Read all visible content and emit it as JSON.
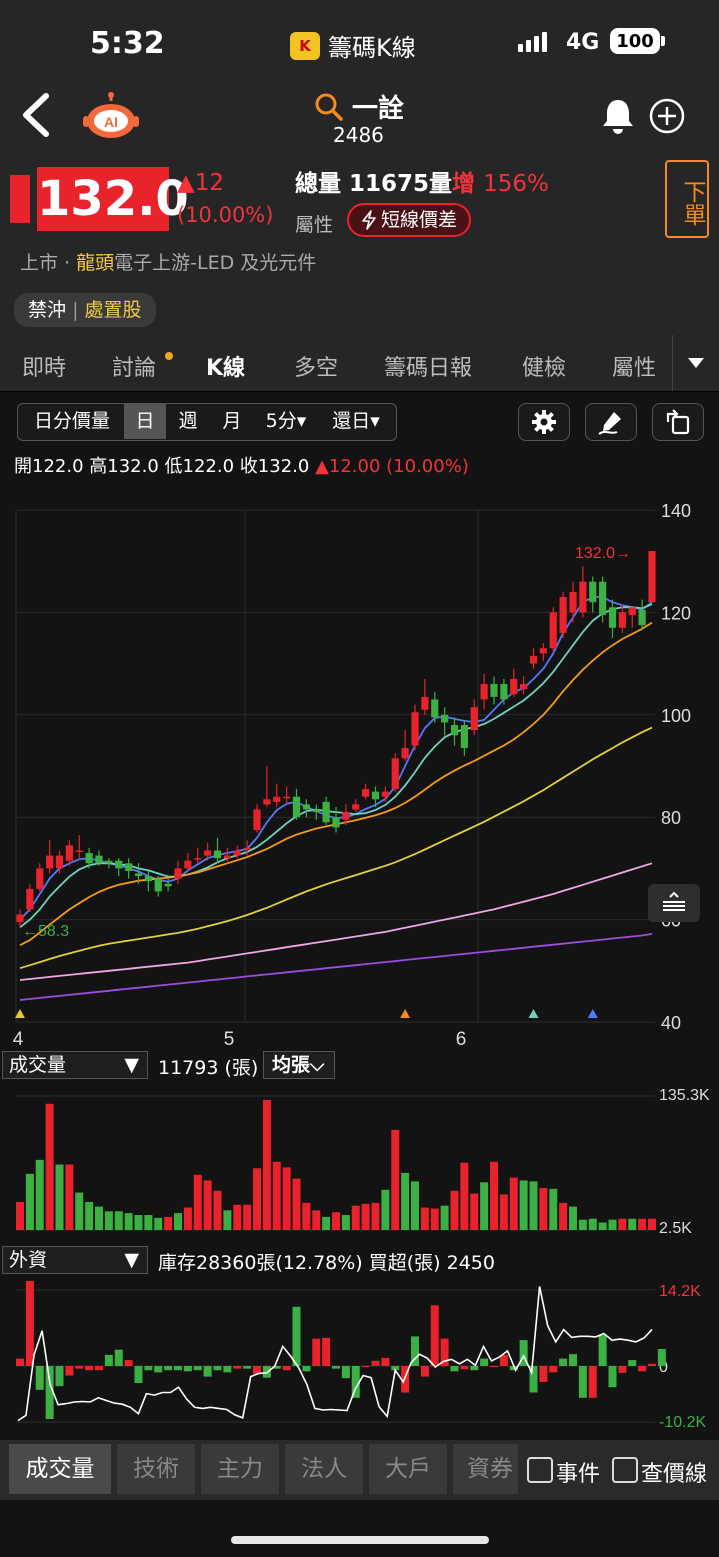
{
  "status": {
    "time": "5:32",
    "app_name": "籌碼K線",
    "network": "4G",
    "battery": "100"
  },
  "header": {
    "search_name": "一詮",
    "stock_code": "2486"
  },
  "quote": {
    "price": "132.0",
    "change": "▲12",
    "change_pct": "(10.00%)",
    "total_volume_label": "總量",
    "total_volume": "11675",
    "volume_label": "量",
    "increase_label": "增",
    "increase_pct": "156%",
    "attribute_label": "屬性",
    "attribute_chip": "短線價差",
    "order_button": "下單",
    "market": "上市",
    "separator": "·",
    "leader_tag": "龍頭",
    "industry": "電子上游-LED 及光元件",
    "restriction_1": "禁沖",
    "restriction_2": "處置股"
  },
  "tabs": [
    "即時",
    "討論",
    "K線",
    "多空",
    "籌碼日報",
    "健檢",
    "屬性"
  ],
  "active_tab": "K線",
  "toolbar": {
    "items": [
      "日分價量",
      "日",
      "週",
      "月",
      "5分▾",
      "還日▾"
    ],
    "active": "日"
  },
  "ohlc": {
    "open_label": "開",
    "open": "122.0",
    "high_label": "高",
    "high": "132.0",
    "low_label": "低",
    "low": "122.0",
    "close_label": "收",
    "close": "132.0",
    "change": "▲12.00 (10.00%)"
  },
  "chart_data": {
    "type": "candlestick",
    "y_ticks": [
      "140",
      "120",
      "100",
      "80",
      "60",
      "40"
    ],
    "ylim": [
      40,
      140
    ],
    "x_ticks": [
      "4",
      "5",
      "6"
    ],
    "last_price_label": "132.0→",
    "low_marker_label": "←58.3",
    "candles": [
      {
        "o": 59.5,
        "c": 61.0,
        "h": 62.0,
        "l": 58.3
      },
      {
        "o": 62.0,
        "c": 66.0,
        "h": 67.0,
        "l": 61.5
      },
      {
        "o": 66.0,
        "c": 70.0,
        "h": 71.0,
        "l": 65.5
      },
      {
        "o": 70.0,
        "c": 72.5,
        "h": 75.5,
        "l": 69.0
      },
      {
        "o": 70.0,
        "c": 72.5,
        "h": 73.5,
        "l": 69.0
      },
      {
        "o": 71.5,
        "c": 74.5,
        "h": 75.5,
        "l": 70.5
      },
      {
        "o": 73.5,
        "c": 73.5,
        "h": 76.5,
        "l": 72.0
      },
      {
        "o": 73.0,
        "c": 71.0,
        "h": 74.0,
        "l": 70.0
      },
      {
        "o": 72.5,
        "c": 71.0,
        "h": 73.5,
        "l": 70.5
      },
      {
        "o": 71.5,
        "c": 71.0,
        "h": 72.0,
        "l": 70.0
      },
      {
        "o": 71.5,
        "c": 70.0,
        "h": 72.0,
        "l": 68.5
      },
      {
        "o": 71.0,
        "c": 69.5,
        "h": 72.0,
        "l": 68.0
      },
      {
        "o": 69.0,
        "c": 68.5,
        "h": 71.0,
        "l": 67.0
      },
      {
        "o": 68.5,
        "c": 67.5,
        "h": 69.5,
        "l": 65.5
      },
      {
        "o": 68.0,
        "c": 65.5,
        "h": 68.5,
        "l": 64.5
      },
      {
        "o": 67.0,
        "c": 66.5,
        "h": 68.0,
        "l": 65.5
      },
      {
        "o": 68.0,
        "c": 70.0,
        "h": 71.5,
        "l": 67.0
      },
      {
        "o": 70.0,
        "c": 71.5,
        "h": 73.0,
        "l": 69.5
      },
      {
        "o": 72.0,
        "c": 72.0,
        "h": 74.0,
        "l": 71.0
      },
      {
        "o": 72.5,
        "c": 73.5,
        "h": 75.0,
        "l": 71.5
      },
      {
        "o": 73.5,
        "c": 72.0,
        "h": 76.0,
        "l": 71.0
      },
      {
        "o": 72.0,
        "c": 72.5,
        "h": 74.0,
        "l": 71.0
      },
      {
        "o": 72.5,
        "c": 73.5,
        "h": 74.5,
        "l": 72.0
      },
      {
        "o": 74.0,
        "c": 74.0,
        "h": 75.5,
        "l": 72.5
      },
      {
        "o": 77.5,
        "c": 81.5,
        "h": 82.5,
        "l": 77.0
      },
      {
        "o": 82.5,
        "c": 83.5,
        "h": 90.0,
        "l": 82.0
      },
      {
        "o": 83.0,
        "c": 84.0,
        "h": 86.5,
        "l": 82.0
      },
      {
        "o": 84.0,
        "c": 84.0,
        "h": 86.0,
        "l": 82.5
      },
      {
        "o": 84.0,
        "c": 80.0,
        "h": 85.5,
        "l": 79.5
      },
      {
        "o": 82.5,
        "c": 81.5,
        "h": 83.5,
        "l": 80.0
      },
      {
        "o": 81.5,
        "c": 81.0,
        "h": 82.5,
        "l": 79.5
      },
      {
        "o": 83.0,
        "c": 79.0,
        "h": 84.0,
        "l": 78.5
      },
      {
        "o": 80.0,
        "c": 78.0,
        "h": 82.0,
        "l": 77.0
      },
      {
        "o": 79.5,
        "c": 81.0,
        "h": 82.5,
        "l": 78.5
      },
      {
        "o": 81.5,
        "c": 82.5,
        "h": 83.5,
        "l": 81.0
      },
      {
        "o": 84.0,
        "c": 85.5,
        "h": 86.5,
        "l": 83.5
      },
      {
        "o": 85.0,
        "c": 83.5,
        "h": 86.0,
        "l": 82.0
      },
      {
        "o": 84.0,
        "c": 85.0,
        "h": 86.0,
        "l": 83.0
      },
      {
        "o": 85.5,
        "c": 91.5,
        "h": 92.5,
        "l": 85.0
      },
      {
        "o": 91.5,
        "c": 93.5,
        "h": 97.0,
        "l": 91.0
      },
      {
        "o": 94.0,
        "c": 100.5,
        "h": 102.0,
        "l": 93.0
      },
      {
        "o": 101.0,
        "c": 103.5,
        "h": 107.0,
        "l": 100.0
      },
      {
        "o": 103.0,
        "c": 99.5,
        "h": 104.5,
        "l": 98.5
      },
      {
        "o": 100.0,
        "c": 98.5,
        "h": 101.5,
        "l": 96.0
      },
      {
        "o": 98.0,
        "c": 96.0,
        "h": 99.5,
        "l": 94.0
      },
      {
        "o": 98.0,
        "c": 93.5,
        "h": 99.0,
        "l": 92.0
      },
      {
        "o": 97.0,
        "c": 101.5,
        "h": 103.0,
        "l": 96.0
      },
      {
        "o": 103.0,
        "c": 106.0,
        "h": 108.0,
        "l": 101.0
      },
      {
        "o": 106.0,
        "c": 103.5,
        "h": 107.5,
        "l": 102.0
      },
      {
        "o": 106.0,
        "c": 103.0,
        "h": 107.0,
        "l": 102.0
      },
      {
        "o": 104.0,
        "c": 107.0,
        "h": 109.0,
        "l": 103.5
      },
      {
        "o": 105.0,
        "c": 106.0,
        "h": 107.5,
        "l": 104.0
      },
      {
        "o": 110.0,
        "c": 111.5,
        "h": 113.0,
        "l": 109.0
      },
      {
        "o": 112.0,
        "c": 113.0,
        "h": 114.0,
        "l": 110.5
      },
      {
        "o": 113.0,
        "c": 120.0,
        "h": 121.0,
        "l": 112.0
      },
      {
        "o": 116.0,
        "c": 123.0,
        "h": 124.0,
        "l": 115.0
      },
      {
        "o": 120.0,
        "c": 124.0,
        "h": 126.0,
        "l": 118.0
      },
      {
        "o": 120.0,
        "c": 126.0,
        "h": 129.0,
        "l": 119.0
      },
      {
        "o": 126.0,
        "c": 122.0,
        "h": 127.0,
        "l": 120.0
      },
      {
        "o": 126.0,
        "c": 119.5,
        "h": 127.0,
        "l": 118.0
      },
      {
        "o": 121.0,
        "c": 117.0,
        "h": 122.5,
        "l": 115.0
      },
      {
        "o": 117.0,
        "c": 120.0,
        "h": 121.5,
        "l": 116.0
      },
      {
        "o": 119.5,
        "c": 121.0,
        "h": 121.0,
        "l": 117.0
      },
      {
        "o": 120.5,
        "c": 117.5,
        "h": 122.5,
        "l": 116.5
      },
      {
        "o": 122.0,
        "c": 132.0,
        "h": 132.0,
        "l": 122.0
      }
    ],
    "moving_averages": [
      {
        "color": "#4f7bff",
        "values": [
          60,
          62,
          65,
          68,
          70,
          71,
          71.8,
          72,
          71.5,
          71,
          70.6,
          70,
          69.4,
          68.5,
          67.8,
          67.4,
          68,
          69.6,
          70.8,
          72,
          72.6,
          73,
          73.4,
          73.8,
          76,
          79,
          81.4,
          82.6,
          83,
          82,
          81.2,
          80.4,
          79.8,
          80,
          80.6,
          81.6,
          82.4,
          83.6,
          86,
          90,
          94,
          97.4,
          99.4,
          99.6,
          99.2,
          98.8,
          98.6,
          99,
          101,
          103,
          104.4,
          105.2,
          107,
          109,
          112,
          116,
          119,
          122,
          123,
          123,
          122,
          121.4,
          121,
          120.6,
          122
        ]
      },
      {
        "color": "#6fd2c0",
        "values": [
          58.5,
          60,
          62,
          64.5,
          66.5,
          68.4,
          69.8,
          70.6,
          71,
          71,
          70.8,
          70.6,
          70,
          69.6,
          69,
          68.4,
          68.4,
          68.8,
          69.4,
          70.2,
          71.2,
          72,
          72.6,
          73.2,
          74.2,
          75.6,
          77.2,
          78.8,
          80.2,
          81.2,
          81.5,
          81.2,
          81,
          80.8,
          80.6,
          80.8,
          81.4,
          82.4,
          84,
          86.2,
          88.8,
          91.6,
          93.8,
          95.6,
          96.6,
          97.2,
          97.6,
          98.2,
          99.2,
          100.4,
          101.6,
          102.8,
          104.4,
          106.2,
          108.4,
          111,
          113.6,
          116.2,
          118.4,
          119.8,
          120.6,
          121,
          121,
          120.8,
          121.6
        ]
      },
      {
        "color": "#f49b1c",
        "values": [
          55,
          56,
          57.5,
          59,
          60.5,
          62,
          63.2,
          64.4,
          65.4,
          66.2,
          66.8,
          67.2,
          67.6,
          67.8,
          68,
          68.2,
          68.4,
          68.8,
          69.2,
          69.8,
          70.4,
          71,
          71.6,
          72.2,
          73,
          73.8,
          74.8,
          75.8,
          76.6,
          77.2,
          77.8,
          78.2,
          78.6,
          79,
          79.4,
          79.9,
          80.4,
          81,
          81.8,
          82.8,
          84,
          85.4,
          86.8,
          88,
          89.1,
          90.1,
          91,
          92,
          93,
          94,
          95.2,
          96.6,
          98.2,
          100,
          102.2,
          104.6,
          106.8,
          108.8,
          110.6,
          112.2,
          113.6,
          114.8,
          115.8,
          116.8,
          118
        ]
      },
      {
        "color": "#e0d23a",
        "values": [
          50.5,
          51.1,
          51.7,
          52.3,
          52.9,
          53.4,
          53.9,
          54.4,
          54.9,
          55.3,
          55.6,
          55.9,
          56.2,
          56.5,
          56.8,
          57.1,
          57.4,
          57.8,
          58.2,
          58.7,
          59.2,
          59.7,
          60.3,
          60.9,
          61.6,
          62.3,
          63.1,
          63.9,
          64.7,
          65.5,
          66.2,
          66.9,
          67.5,
          68.1,
          68.7,
          69.3,
          69.9,
          70.5,
          71.2,
          72,
          72.8,
          73.7,
          74.6,
          75.5,
          76.4,
          77.3,
          78.2,
          79.1,
          80.1,
          81.1,
          82.1,
          83.1,
          84.2,
          85.3,
          86.5,
          87.7,
          88.9,
          90.1,
          91.3,
          92.4,
          93.5,
          94.6,
          95.6,
          96.6,
          97.5
        ]
      },
      {
        "color": "#f0a6e6",
        "values": [
          48.2,
          48.4,
          48.6,
          48.8,
          49,
          49.2,
          49.4,
          49.6,
          49.8,
          50,
          50.2,
          50.4,
          50.6,
          50.8,
          51,
          51.2,
          51.4,
          51.6,
          51.9,
          52.2,
          52.5,
          52.8,
          53.1,
          53.4,
          53.7,
          54,
          54.3,
          54.6,
          54.9,
          55.2,
          55.5,
          55.8,
          56.1,
          56.4,
          56.7,
          57,
          57.3,
          57.6,
          58,
          58.4,
          58.8,
          59.2,
          59.6,
          60,
          60.4,
          60.8,
          61.2,
          61.6,
          62,
          62.5,
          63,
          63.5,
          64,
          64.5,
          65,
          65.6,
          66.2,
          66.8,
          67.4,
          68,
          68.6,
          69.2,
          69.8,
          70.4,
          71
        ]
      },
      {
        "color": "#9c4ee0",
        "values": [
          44.3,
          44.5,
          44.7,
          44.9,
          45.1,
          45.3,
          45.5,
          45.7,
          45.9,
          46.1,
          46.3,
          46.5,
          46.7,
          46.9,
          47.1,
          47.3,
          47.5,
          47.7,
          47.9,
          48.1,
          48.3,
          48.5,
          48.7,
          48.9,
          49.1,
          49.3,
          49.5,
          49.7,
          49.9,
          50.1,
          50.3,
          50.5,
          50.7,
          50.9,
          51.1,
          51.3,
          51.5,
          51.7,
          51.9,
          52.1,
          52.3,
          52.5,
          52.7,
          52.9,
          53.1,
          53.3,
          53.5,
          53.7,
          53.9,
          54.1,
          54.3,
          54.5,
          54.7,
          54.9,
          55.1,
          55.3,
          55.5,
          55.7,
          55.9,
          56.1,
          56.3,
          56.5,
          56.7,
          56.9,
          57.2
        ]
      }
    ],
    "event_markers": [
      {
        "index": 0,
        "color": "#e3c73a"
      },
      {
        "index": 39,
        "color": "#f08a1c"
      },
      {
        "index": 52,
        "color": "#6fd2c0"
      },
      {
        "index": 58,
        "color": "#4f7bff"
      }
    ]
  },
  "volume_panel": {
    "selector": "成交量",
    "arrow": "▼",
    "value": "11793 (張)",
    "mode": "均張⌵",
    "y_max": "135.3K",
    "y_min": "2.5K",
    "bars": [
      3,
      6,
      7.5,
      13.5,
      7,
      7,
      4,
      3,
      2.5,
      2,
      2,
      1.8,
      1.6,
      1.6,
      1.3,
      1.4,
      1.8,
      2.4,
      5.9,
      5.3,
      4.2,
      2.1,
      2.7,
      2.7,
      6.6,
      13.9,
      7.3,
      6.7,
      5.5,
      2.9,
      2.1,
      1.4,
      1.9,
      1.6,
      2.6,
      2.8,
      2.9,
      4.3,
      10.7,
      6.1,
      5.2,
      2.4,
      2.3,
      2.6,
      4.2,
      7.2,
      3.9,
      5.1,
      7.3,
      3.8,
      5.6,
      5.3,
      5.2,
      4.5,
      4.4,
      2.9,
      2.5,
      1.1,
      1.2,
      0.8,
      1.1,
      1.2,
      1.2,
      1.2,
      1.2
    ],
    "colors": "rggrgrgggggggggrgrrrrgrrrrrrrrrgrgrrrgrggrrgrrrgrrrggrgrgggggrgrr"
  },
  "foreign_panel": {
    "selector": "外資",
    "arrow": "▼",
    "inventory": "庫存28360張(12.78%)",
    "net_buy": "買超(張) 2450",
    "y_max": "14.2K",
    "y_zero": "0",
    "y_min": "-10.2K",
    "bars": [
      1,
      11.5,
      -4.5,
      -10,
      -3.8,
      -1.8,
      -0.5,
      -0.8,
      -0.8,
      1.5,
      2.2,
      0.8,
      -3.2,
      -0.8,
      -1.2,
      -0.8,
      -0.8,
      -1,
      -0.8,
      -2,
      -0.8,
      -1.2,
      -0.5,
      -0.5,
      -1.5,
      -2.2,
      -0.5,
      -0.8,
      8,
      -1,
      3.7,
      3.8,
      -0.5,
      -2.3,
      -6,
      -0.2,
      0.7,
      1.1,
      -0.8,
      -5,
      4,
      -2,
      8.2,
      3.7,
      -1,
      -0.6,
      -0.8,
      1,
      -0.2,
      1.5,
      -0.8,
      3.5,
      -5,
      -3,
      -1.2,
      1,
      1.6,
      -6,
      -6,
      4.2,
      -4,
      -1.3,
      0.8,
      -1,
      0.3,
      2.3
    ],
    "colors": "rrgggrrrrggrggggggggggrgrggrggrrgggrrrgrgrrrgrggrrgggrrgggrggrgrr",
    "line": [
      -10.3,
      -9.3,
      2,
      6.3,
      -3.5,
      -7.3,
      -7.1,
      -6.8,
      -6.7,
      -6.8,
      -6,
      -6.5,
      -7,
      -7.2,
      -7.8,
      -9,
      -5.2,
      -5.5,
      -5,
      -5,
      -4,
      -6.2,
      -7.8,
      -8,
      -7.8,
      -8,
      -8.2,
      -9.2,
      -9.8,
      -2,
      -1.4,
      -1.3,
      0,
      3.5,
      1.7,
      -0.4,
      -3.5,
      -8,
      -8.3,
      -8.2,
      -8.3,
      -8.4,
      -4.4,
      -1.8,
      -2.2,
      -7.7,
      -9.5,
      -0.8,
      -3,
      0.6,
      2.1,
      1.4,
      -0.2,
      0.8,
      1.2,
      0.4,
      1.2,
      0.1,
      3.5,
      0.9,
      1.6,
      2.7,
      -0.8,
      1.8,
      -1.2,
      14.2,
      7.2,
      4.3,
      6.5,
      5.1,
      5.3,
      5.3,
      5.2,
      5.8,
      4.6,
      4.8,
      4.6,
      4.3,
      5,
      6.5
    ]
  },
  "bottom_tabs": {
    "items": [
      "成交量",
      "技術",
      "主力",
      "法人",
      "大戶",
      "資券"
    ],
    "active": "成交量",
    "checkbox_1": "事件",
    "checkbox_2": "查價線"
  }
}
